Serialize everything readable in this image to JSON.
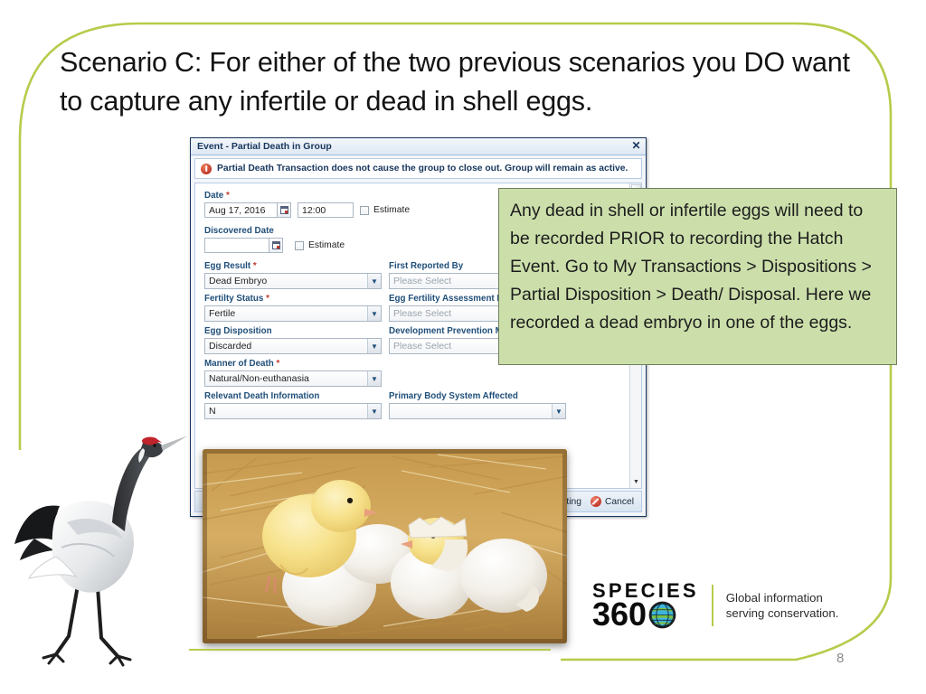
{
  "slide": {
    "title": "Scenario C: For either of the two previous scenarios you DO want to capture any infertile or dead in shell eggs.",
    "page_number": "8",
    "accent_color": "#b5cc4a"
  },
  "dialog": {
    "title": "Event - Partial Death in Group",
    "close_label": "✕",
    "banner_text": "Partial Death Transaction does not cause the group to close out. Group will remain as active.",
    "fields": {
      "date_label": "Date",
      "date_required": "*",
      "date_value": "Aug 17, 2016",
      "time_value": "12:00",
      "date_estimate_label": "Estimate",
      "discovered_date_label": "Discovered Date",
      "discovered_date_value": "",
      "discovered_estimate_label": "Estimate",
      "egg_result_label": "Egg Result",
      "egg_result_value": "Dead Embryo",
      "first_reported_by_label": "First Reported By",
      "first_reported_by_value": "Please Select",
      "fertility_status_label": "Fertilty Status",
      "fertility_status_value": "Fertile",
      "egg_fertility_assessment_label": "Egg Fertility Assessment M",
      "egg_fertility_assessment_value": "Please Select",
      "egg_disposition_label": "Egg Disposition",
      "egg_disposition_value": "Discarded",
      "development_prevention_label": "Development Prevention Method",
      "development_prevention_value": "Please Select",
      "manner_of_death_label": "Manner of Death",
      "manner_of_death_value": "Natural/Non-euthanasia",
      "relevant_death_info_label": "Relevant Death Information",
      "relevant_death_info_value": "N",
      "primary_body_system_label": "Primary Body System Affected"
    },
    "footer": {
      "continue_label": "e editing",
      "cancel_label": "Cancel"
    }
  },
  "callout": {
    "text": "Any dead in shell or infertile eggs will need to be recorded PRIOR to recording the Hatch Event. Go to My Transactions > Dispositions > Partial Disposition > Death/ Disposal. Here we recorded a dead embryo in one of the eggs.",
    "background": "#ccdfab"
  },
  "logo": {
    "species_text": "SPECIES",
    "number_text": "360",
    "tagline_line1": "Global information",
    "tagline_line2": "serving conservation."
  }
}
